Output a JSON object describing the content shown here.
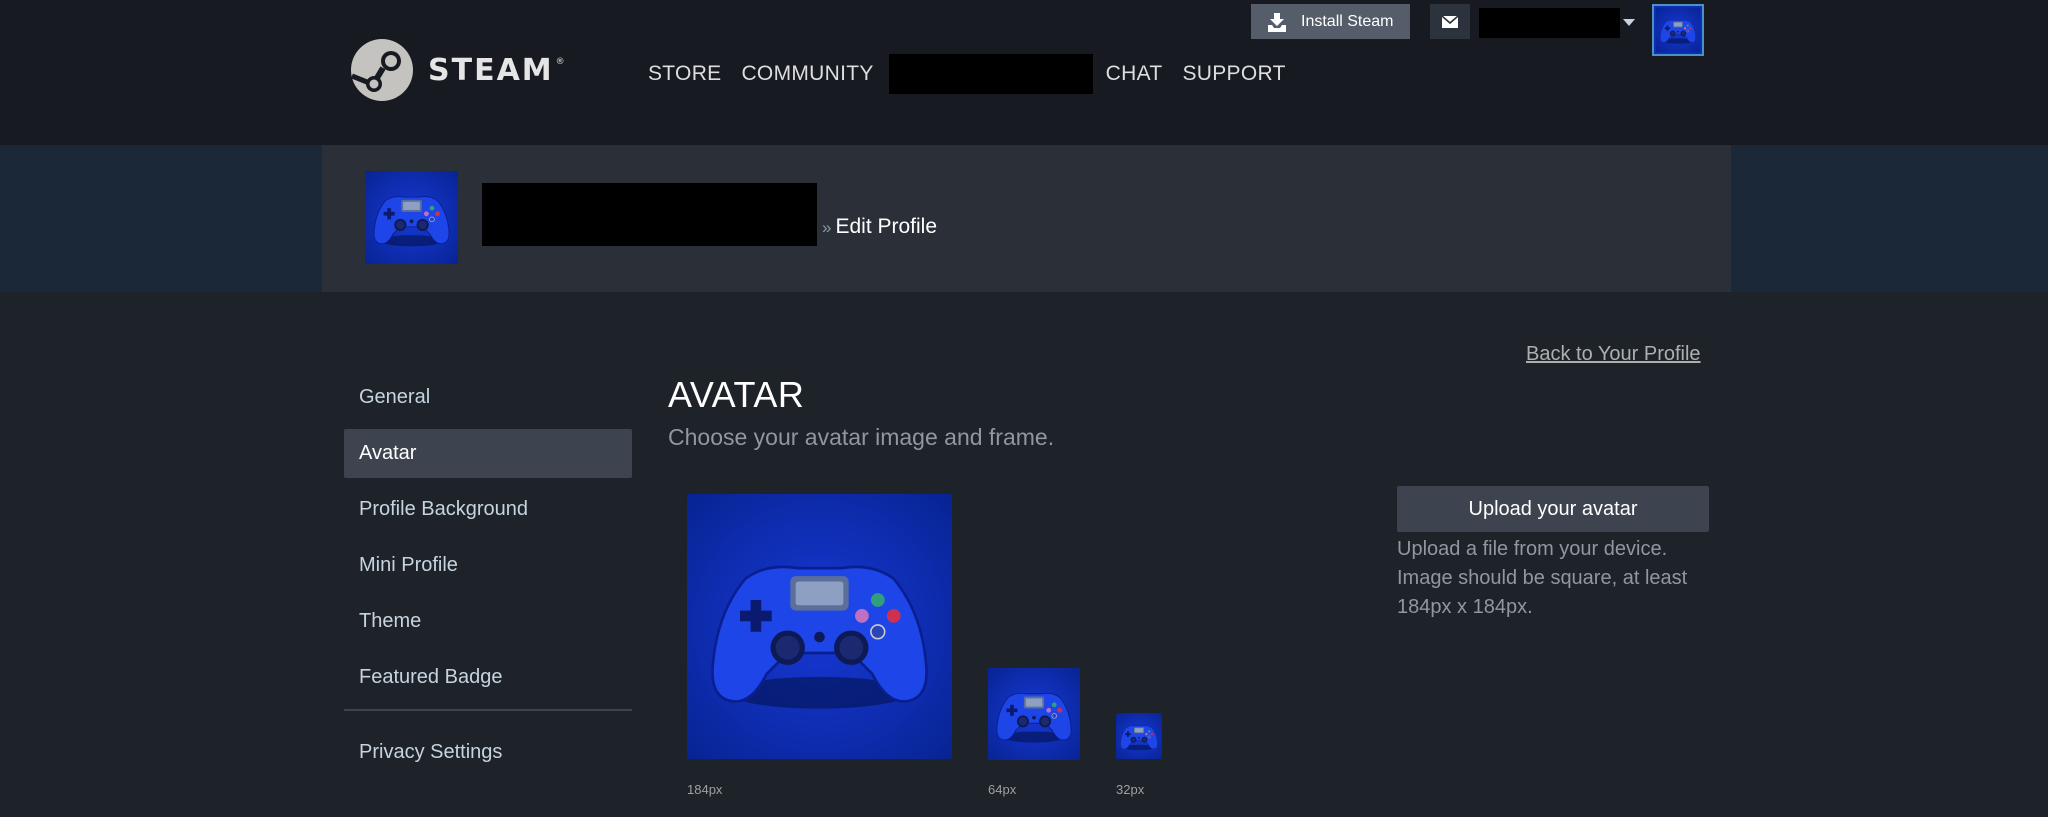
{
  "header": {
    "logo_text": "STEAM",
    "logo_reg": "®",
    "nav": [
      "STORE",
      "COMMUNITY",
      "CHAT",
      "SUPPORT"
    ],
    "install_label": "Install Steam"
  },
  "profile": {
    "breadcrumb_sep": "»",
    "breadcrumb_page": "Edit Profile"
  },
  "back_link": "Back to Your Profile",
  "sidebar": {
    "items": [
      {
        "label": "General"
      },
      {
        "label": "Avatar"
      },
      {
        "label": "Profile Background"
      },
      {
        "label": "Mini Profile"
      },
      {
        "label": "Theme"
      },
      {
        "label": "Featured Badge"
      }
    ],
    "footer_item": "Privacy Settings",
    "active": "Avatar"
  },
  "main": {
    "title": "AVATAR",
    "subtitle": "Choose your avatar image and frame.",
    "previews": [
      {
        "label": "184px"
      },
      {
        "label": "64px"
      },
      {
        "label": "32px"
      }
    ],
    "upload_label": "Upload your avatar",
    "upload_help": "Upload a file from your device. Image should be square, at least 184px x 184px."
  },
  "icons": {
    "logo": "steam-logo-icon",
    "install": "download-icon",
    "mail": "envelope-icon",
    "caret": "caret-down-icon",
    "avatar": "gamepad-image"
  },
  "colors": {
    "header_bg": "#171a21",
    "page_bg": "#1b2838",
    "strip_bg": "#2a2f38",
    "content_bg": "#1e2229",
    "active_item": "#3d4450",
    "avatar_blue": "#0c2eb5"
  }
}
